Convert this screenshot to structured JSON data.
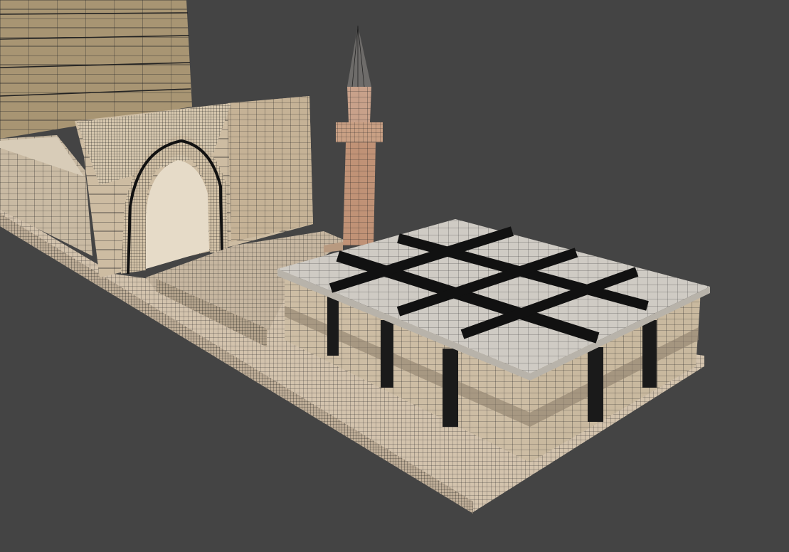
{
  "viewport": {
    "background": "#444444",
    "display_mode": "textured-wireframe",
    "wire_color": "#111111"
  },
  "scene": {
    "objects": [
      {
        "name": "back-wall-panel",
        "material": "sandstone-blocks",
        "color": "#a89573"
      },
      {
        "name": "perimeter-wall-left",
        "material": "limestone",
        "color": "#c9baa3"
      },
      {
        "name": "portal-gate",
        "material": "limestone",
        "color": "#cdbca2"
      },
      {
        "name": "pointed-arch",
        "material": "limestone",
        "color": "#d2c1a6"
      },
      {
        "name": "minaret",
        "material": "terracotta",
        "color": "#c09276"
      },
      {
        "name": "courtyard-ramp",
        "material": "stone-pavers",
        "color": "#c6b6a0"
      },
      {
        "name": "mosque-building",
        "material": "limestone",
        "color": "#cdbda4"
      },
      {
        "name": "mosque-roof",
        "material": "marble",
        "color": "#cfcbc4"
      },
      {
        "name": "ground-platform",
        "material": "stone-pavers",
        "color": "#d3c3ad"
      }
    ]
  }
}
